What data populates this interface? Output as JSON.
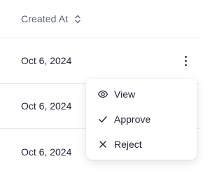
{
  "table": {
    "column_header": "Created At",
    "sort_icon": "chevron-up-down-icon",
    "rows": [
      {
        "created_at": "Oct 6, 2024"
      },
      {
        "created_at": "Oct 6, 2024"
      },
      {
        "created_at": "Oct 6, 2024"
      }
    ]
  },
  "row_actions": {
    "trigger_icon": "more-vertical-icon",
    "menu": [
      {
        "label": "View",
        "icon": "eye-icon"
      },
      {
        "label": "Approve",
        "icon": "check-icon"
      },
      {
        "label": "Reject",
        "icon": "x-icon"
      }
    ]
  },
  "colors": {
    "text": "#1f2430",
    "header_text": "#5b6372",
    "divider": "#e6e8ec"
  }
}
